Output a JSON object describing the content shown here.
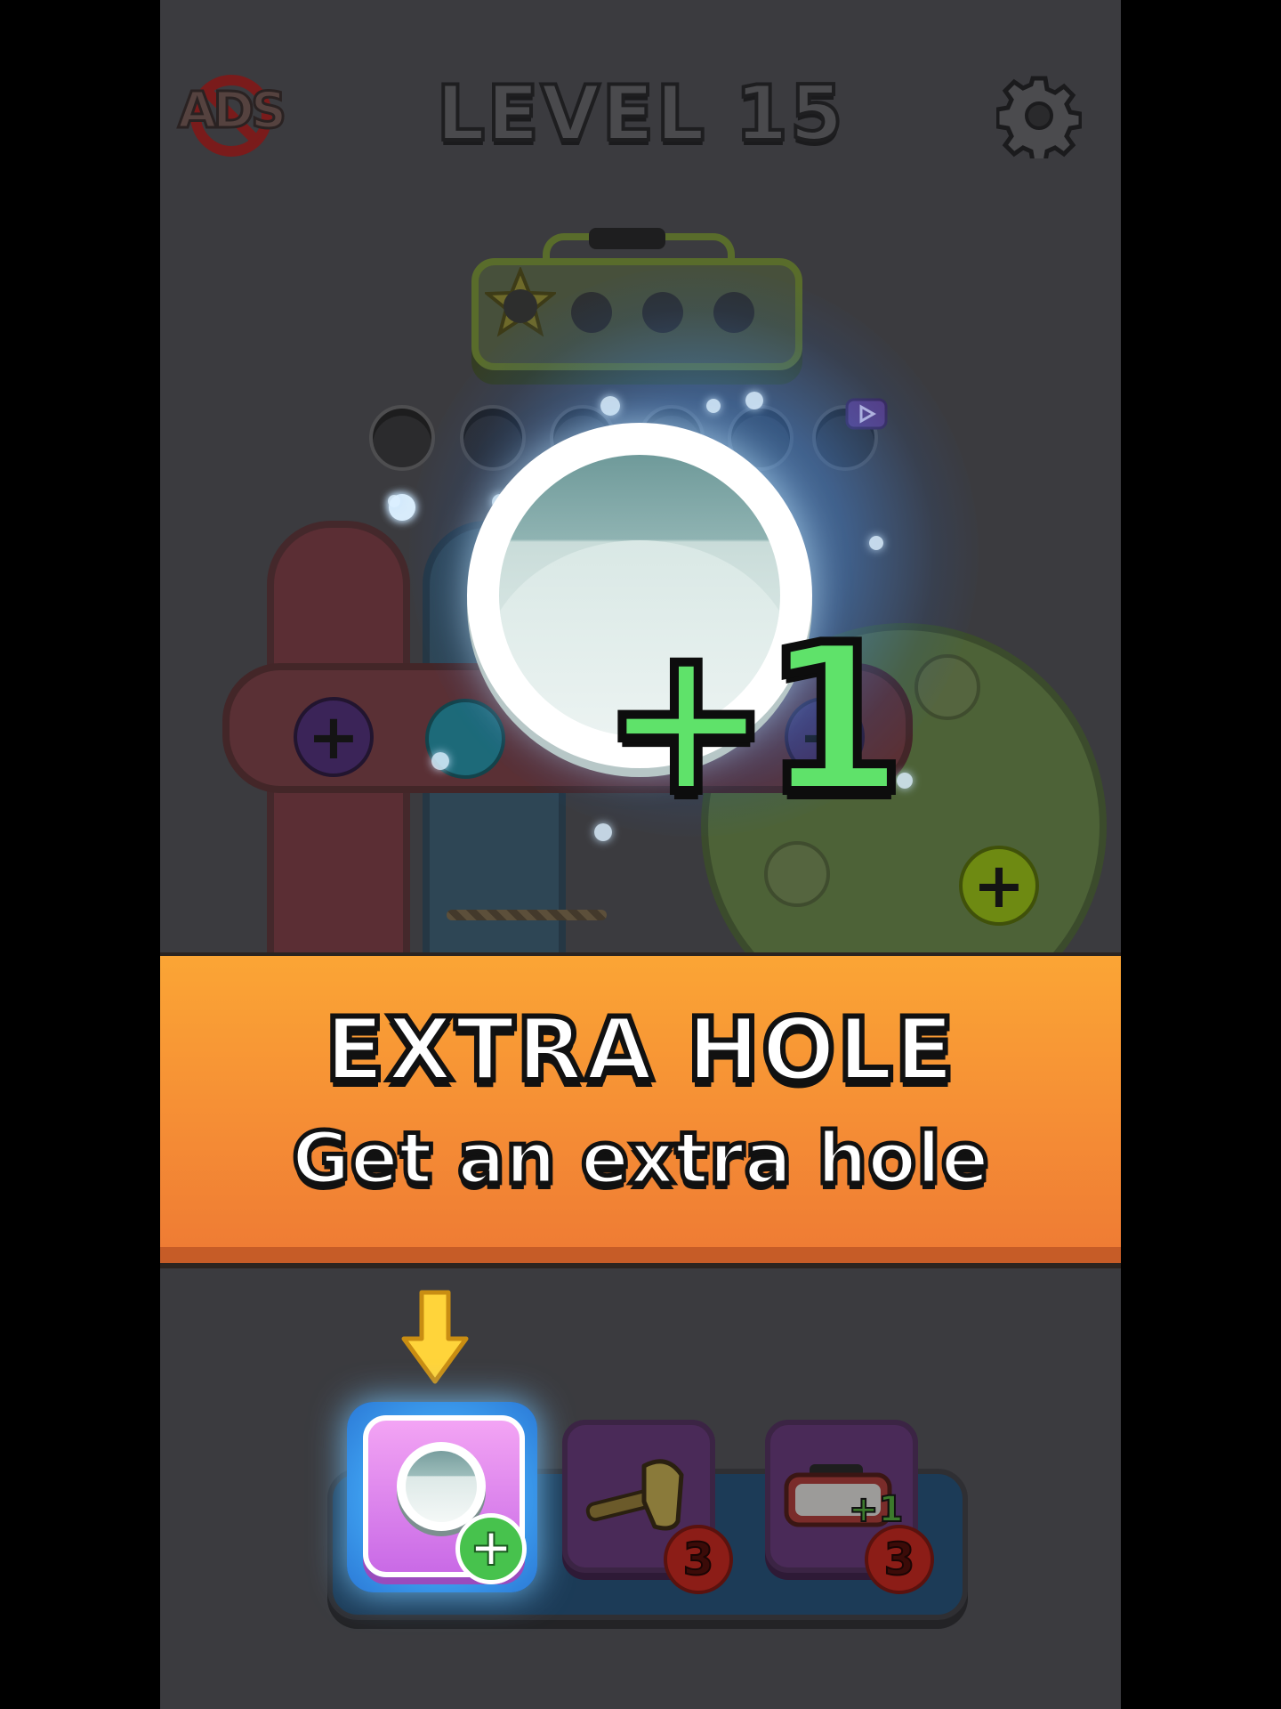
{
  "header": {
    "level_title": "LEVEL 15",
    "no_ads_label": "ADS",
    "settings_icon": "gear-icon"
  },
  "board": {
    "toolbox_slots": 4,
    "toolbox_filled_slots": 1,
    "empty_holes": 6,
    "ad_icon": "play-video-icon"
  },
  "featured": {
    "icon": "hole-icon",
    "bonus_label": "+1"
  },
  "banner": {
    "title": "EXTRA HOLE",
    "subtitle": "Get an extra hole"
  },
  "boosters": [
    {
      "name": "extra-hole",
      "icon": "hole-icon",
      "badge": "+",
      "selected": true
    },
    {
      "name": "hammer",
      "icon": "hammer-icon",
      "count": "3"
    },
    {
      "name": "extra-toolbox",
      "icon": "toolbox-plus-one-icon",
      "count": "3",
      "overlay": "+1"
    }
  ],
  "colors": {
    "banner": "#f7963a",
    "bonus_green": "#5fe26a",
    "glow_blue": "#3ea0f0",
    "booster_purple": "#c96ae6",
    "count_red": "#8c1d17"
  }
}
